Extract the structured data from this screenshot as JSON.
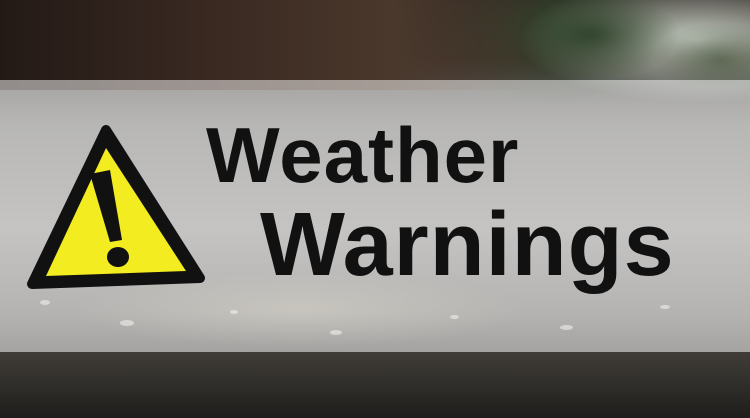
{
  "headline": {
    "line1": "Weather",
    "line2": "Warnings"
  },
  "icons": {
    "warning": "warning-triangle-icon"
  },
  "colors": {
    "warning_yellow": "#f3ec20",
    "warning_black": "#111111",
    "band_overlay": "rgba(255,255,255,0.5)"
  }
}
